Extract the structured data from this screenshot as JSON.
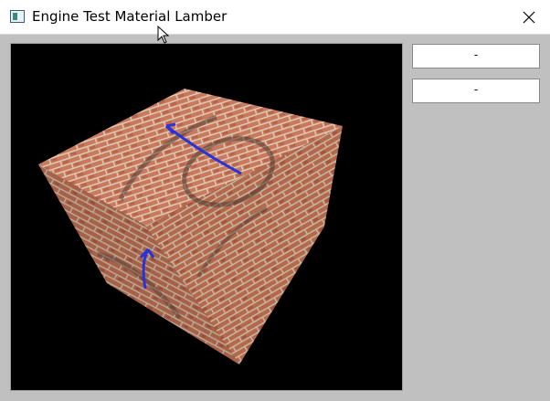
{
  "window": {
    "title": "Engine Test Material Lamber",
    "icon": "window-app-icon",
    "close_icon": "close-icon"
  },
  "viewport": {
    "background": "#000000",
    "scene": "textured-brick-cube"
  },
  "side_panel": {
    "buttons": [
      {
        "label": "-"
      },
      {
        "label": "-"
      }
    ]
  },
  "colors": {
    "window_bg": "#c0c0c0",
    "titlebar_bg": "#ffffff",
    "brick": "#b8664a",
    "mortar": "#d8c6b4",
    "arrow": "#2a32d8"
  }
}
